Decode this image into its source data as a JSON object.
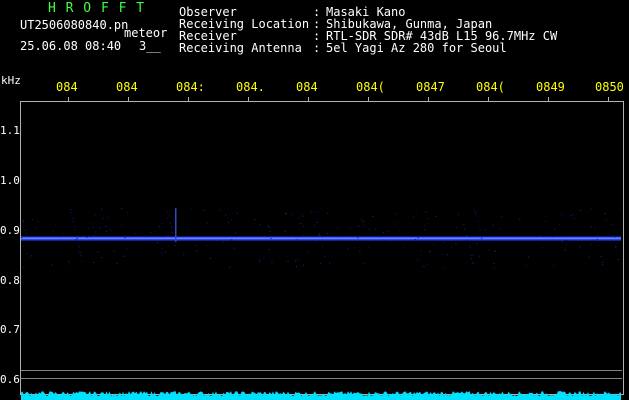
{
  "logo": "H R O F F T",
  "file_name": "UT2506080840.pn",
  "file_suffix": "meteor",
  "date_time": "25.06.08 08:40",
  "count": "3__",
  "info": {
    "labels": [
      "Observer",
      "Receiving Location",
      "Receiver",
      "Receiving Antenna"
    ],
    "colons": [
      ":",
      ":",
      ":",
      ":"
    ],
    "values": [
      "Masaki Kano",
      "Shibukawa, Gunma, Japan",
      "RTL-SDR SDR# 43dB L15 96.7MHz CW",
      "5el Yagi Az 280 for Seoul"
    ]
  },
  "axis": {
    "unit": "kHz",
    "y_ticks": [
      "1.1",
      "1.0",
      "0.9",
      "0.8",
      "0.7",
      "0.6"
    ],
    "x_ticks": [
      "084",
      "084",
      "084:",
      "084.",
      "084",
      "084(",
      "0847",
      "084(",
      "0849",
      "0850"
    ]
  },
  "colors": {
    "signal": "#2040ff",
    "noise": "#00e0ff",
    "frame": "#b0b0b0"
  },
  "signal_frequency_khz": 0.885
}
